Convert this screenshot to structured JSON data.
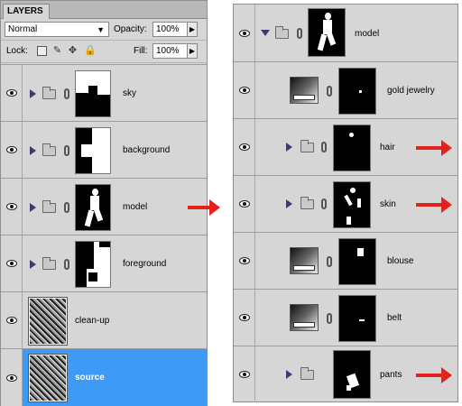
{
  "left_panel": {
    "tab_label": "LAYERS",
    "blend_mode": "Normal",
    "opacity_label": "Opacity:",
    "opacity_value": "100%",
    "lock_label": "Lock:",
    "fill_label": "Fill:",
    "fill_value": "100%",
    "layers": [
      {
        "name": "sky"
      },
      {
        "name": "background"
      },
      {
        "name": "model"
      },
      {
        "name": "foreground"
      },
      {
        "name": "clean-up"
      },
      {
        "name": "source"
      }
    ]
  },
  "right_panel": {
    "group_name": "model",
    "layers": [
      {
        "name": "gold jewelry"
      },
      {
        "name": "hair"
      },
      {
        "name": "skin"
      },
      {
        "name": "blouse"
      },
      {
        "name": "belt"
      },
      {
        "name": "pants"
      }
    ]
  },
  "colors": {
    "selection": "#3d9af5",
    "arrow": "#e4221b",
    "panel_bg": "#d6d6d6"
  }
}
